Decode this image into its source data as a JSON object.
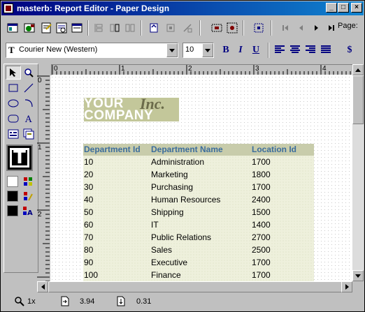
{
  "window": {
    "title": "masterb: Report Editor - Paper Design"
  },
  "toolbar": {
    "page_label": "Page:"
  },
  "format": {
    "font_name": "Courier New (Western)",
    "font_size": "10",
    "bold_label": "B",
    "italic_label": "I",
    "underline_label": "U",
    "currency_label": "$"
  },
  "ruler": {
    "h_labels": [
      "0",
      "1",
      "2",
      "3",
      "4"
    ],
    "v_labels": [
      "0",
      "1",
      "2"
    ]
  },
  "report": {
    "logo": {
      "line1": "YOUR",
      "inc": "Inc.",
      "line2": "COMPANY"
    },
    "columns": [
      "Department Id",
      "Department Name",
      "Location Id"
    ],
    "rows": [
      [
        "10",
        "Administration",
        "1700"
      ],
      [
        "20",
        "Marketing",
        "1800"
      ],
      [
        "30",
        "Purchasing",
        "1700"
      ],
      [
        "40",
        "Human Resources",
        "2400"
      ],
      [
        "50",
        "Shipping",
        "1500"
      ],
      [
        "60",
        "IT",
        "1400"
      ],
      [
        "70",
        "Public Relations",
        "2700"
      ],
      [
        "80",
        "Sales",
        "2500"
      ],
      [
        "90",
        "Executive",
        "1700"
      ],
      [
        "100",
        "Finance",
        "1700"
      ]
    ]
  },
  "status": {
    "zoom": "1x",
    "x_position": "3.94",
    "y_position": "0.31"
  },
  "colors": {
    "title_bar": "#000080",
    "header_band": "#c8ccab",
    "header_text": "#3c6d9c",
    "logo_bg": "#c3c79a"
  }
}
